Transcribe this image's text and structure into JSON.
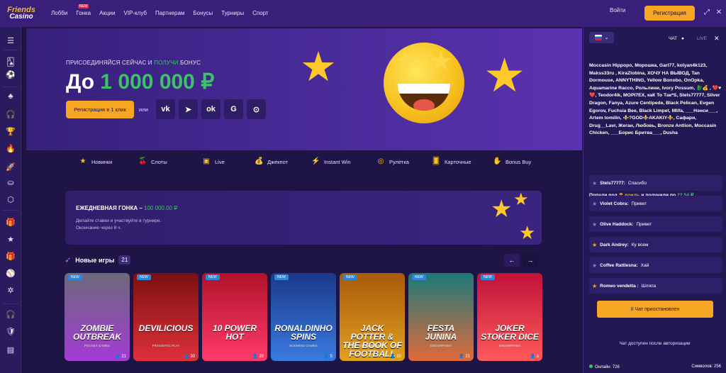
{
  "brand": {
    "line1": "Friends",
    "line2": "Casino"
  },
  "nav": {
    "items": [
      {
        "label": "Лобби"
      },
      {
        "label": "Гонка",
        "badge": "NEW"
      },
      {
        "label": "Акции"
      },
      {
        "label": "VIP-клуб"
      },
      {
        "label": "Партнерам"
      },
      {
        "label": "Бонусы"
      },
      {
        "label": "Турниры"
      },
      {
        "label": "Спорт"
      }
    ],
    "login": "Войти",
    "register": "Регистрация",
    "icons": [
      "expand-icon",
      "close-icon"
    ]
  },
  "sidebar": {
    "icons": [
      "menu-icon",
      "cards-icon",
      "soccer-icon",
      "games-icon",
      "headset-icon",
      "trophy-icon",
      "fire-icon",
      "rocket-icon",
      "chip-icon",
      "hex-icon",
      "gift-icon",
      "star-icon",
      "present-icon",
      "sport-icon",
      "sparkle-icon",
      "support-icon",
      "shield-icon",
      "document-icon"
    ]
  },
  "hero": {
    "subtitle_a": "ПРИСОЕДИНЯЙСЯ СЕЙЧАС И ",
    "subtitle_hl": "ПОЛУЧИ",
    "subtitle_b": " БОНУС",
    "amount_prefix": "До ",
    "amount": "1 000 000 ₽",
    "cta": "Регистрация в 1 клик",
    "or": "или",
    "social": [
      "vk-icon",
      "telegram-icon",
      "ok-icon",
      "google-icon",
      "steam-icon"
    ]
  },
  "categories": [
    {
      "label": "Новинки",
      "icon": "star-icon"
    },
    {
      "label": "Слоты",
      "icon": "cherry-icon"
    },
    {
      "label": "Live",
      "icon": "live-icon"
    },
    {
      "label": "Джекпот",
      "icon": "moneybag-icon"
    },
    {
      "label": "Instant Win",
      "icon": "bolt-icon"
    },
    {
      "label": "Рулетка",
      "icon": "roulette-icon"
    },
    {
      "label": "Карточные",
      "icon": "card-icon"
    },
    {
      "label": "Bonus Buy",
      "icon": "hand-icon"
    }
  ],
  "race": {
    "title": "ЕЖЕДНЕВНАЯ ГОНКА – ",
    "amount": "100 000.00 ₽",
    "line1": "Делайте ставки и участвуйте в турнире.",
    "line2": "Окончание через 8 ч."
  },
  "new_games": {
    "title": "Новые игры",
    "count": "21",
    "games": [
      {
        "badge": "NEW",
        "name": "ZOMBIE OUTBREAK",
        "provider": "POCKET GAMES",
        "players": "21",
        "colors": [
          "#6a6a7a",
          "#a43ad6"
        ]
      },
      {
        "badge": "NEW",
        "name": "DEVILICIOUS",
        "provider": "PRAGMATIC PLAY",
        "players": "30",
        "colors": [
          "#7a1010",
          "#e0303a"
        ]
      },
      {
        "badge": "NEW",
        "name": "10 POWER HOT",
        "provider": "",
        "players": "28",
        "colors": [
          "#b0122a",
          "#ff3a6a"
        ]
      },
      {
        "badge": "NEW",
        "name": "RONALDINHO SPINS",
        "provider": "BOOMING GAMES",
        "players": "5",
        "colors": [
          "#1a3a8a",
          "#3a7ae0"
        ]
      },
      {
        "badge": "NEW",
        "name": "JACK POTTER & THE BOOK OF FOOTBALL",
        "provider": "WIPPART GAMES",
        "players": "10",
        "colors": [
          "#a85a0a",
          "#e0a020"
        ]
      },
      {
        "badge": "NEW",
        "name": "FESTA JUNINA",
        "provider": "ENDORPHINA",
        "players": "21",
        "colors": [
          "#1a7a7a",
          "#e06a3a"
        ]
      },
      {
        "badge": "NEW",
        "name": "JOKER STOKER DICE",
        "provider": "ENDORPHINA",
        "players": "5",
        "colors": [
          "#c0123a",
          "#ff5a5a"
        ]
      }
    ]
  },
  "chat": {
    "tab_chat": "ЧАТ",
    "tab_live": "LIVE",
    "rain_names": "Moccasin Hippopo, Морошка, Garl77, kolyan4k123, Makss33ru , KiraZlobina, ХОЧУ НА ВЫВОД, Tan Dormouse, ANNYTHING, Yellow Bonobo, OnOpka, Aquamarine Racco, Рольлини, Ivory Possum, 🐉💰 , ❤️♥❤️, Teodor4ik, МОРІ7ЕХ, каК То Так*S, Stels77777, Silver Dragon, Fanya, Azure Centipede, Black Pelican, Evgen Egorov, Fuchsia Bee, Black Limpet, Mlifa, ___Нэнси___, Artem tomilin, ⚜️?GOD⚜️AKAKIY⚜️, Сафари, Drug__Lavr, Жеган, Любовь, Bronze Antlion, Moccasin Chicken, ___Борис Бритва___, Dusha",
    "rain_a": "Попали под ",
    "rain_b": "дождь",
    "rain_c": " и получили по ",
    "rain_amt": "27.54 ₽",
    "messages": [
      {
        "name": "Stels77777:",
        "text": "Спасибо",
        "gold": false
      },
      {
        "name": "Violet Cobra:",
        "text": "Привет",
        "gold": false
      },
      {
        "name": "Olive Haddock:",
        "text": "Привет",
        "gold": false
      },
      {
        "name": "Dark Andrey:",
        "text": "Ку всем",
        "gold": true
      },
      {
        "name": "Coffee Rattlesna:",
        "text": "Хай",
        "gold": false
      },
      {
        "name": "Romeo vendetta :",
        "text": "Шляпа",
        "gold": true
      }
    ],
    "paused": "II Чат приостановлен",
    "login_note": "Чат доступен после авторизации",
    "online": "Онлайн: 726",
    "chars": "Символов: 256"
  }
}
